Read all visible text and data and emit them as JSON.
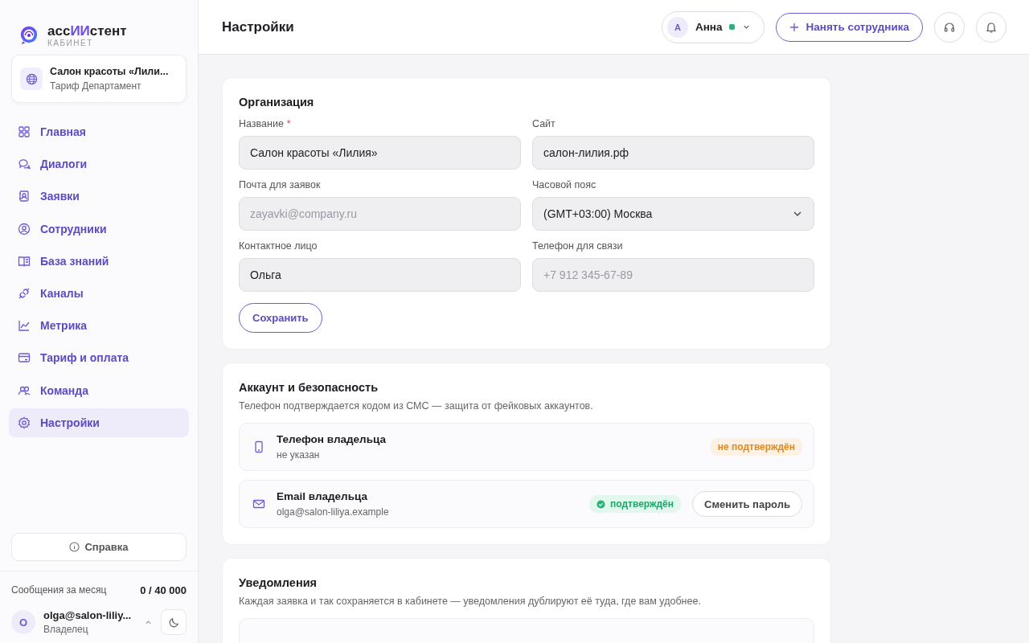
{
  "logo": {
    "parts": [
      {
        "text": "асс",
        "accent": false
      },
      {
        "text": "ИИ",
        "accent": true
      },
      {
        "text": "стент",
        "accent": false
      }
    ],
    "subtitle": "КАБИНЕТ"
  },
  "organization_card": {
    "name": "Салон красоты «Лили...",
    "plan": "Тариф Департамент"
  },
  "nav": [
    {
      "label": "Главная",
      "selected": false
    },
    {
      "label": "Диалоги",
      "selected": false
    },
    {
      "label": "Заявки",
      "selected": false
    },
    {
      "label": "Сотрудники",
      "selected": false
    },
    {
      "label": "База знаний",
      "selected": false
    },
    {
      "label": "Каналы",
      "selected": false
    },
    {
      "label": "Метрика",
      "selected": false
    },
    {
      "label": "Тариф и оплата",
      "selected": false
    },
    {
      "label": "Команда",
      "selected": false
    },
    {
      "label": "Настройки",
      "selected": true
    }
  ],
  "help_button": "Справка",
  "usage": {
    "label": "Сообщения за месяц",
    "value": "0 / 40 000"
  },
  "account": {
    "initial": "O",
    "email": "olga@salon-liliy...",
    "role": "Владелец"
  },
  "header": {
    "title": "Настройки",
    "user": {
      "initial": "А",
      "name": "Анна",
      "online": true
    },
    "hire_button": "Нанять сотрудника"
  },
  "organization": {
    "title": "Организация",
    "fields": [
      {
        "kind": "text",
        "label": "Название",
        "required_mark": "*",
        "value": "Салон красоты «Лилия»"
      },
      {
        "kind": "text",
        "label": "Сайт",
        "value": "салон-лилия.рф"
      },
      {
        "kind": "text",
        "label": "Почта для заявок",
        "placeholder": "zayavki@company.ru"
      },
      {
        "kind": "select",
        "label": "Часовой пояс",
        "value": "(GMT+03:00) Москва"
      },
      {
        "kind": "text",
        "label": "Контактное лицо",
        "value": "Ольга"
      },
      {
        "kind": "text",
        "label": "Телефон для связи",
        "placeholder": "+7 912 345-67-89"
      }
    ],
    "save_button": "Сохранить"
  },
  "security": {
    "title": "Аккаунт и безопасность",
    "description": "Телефон подтверждается кодом из СМС — защита от фейковых аккаунтов.",
    "rows": [
      {
        "kind": "phone",
        "title": "Телефон владельца",
        "value": "не указан",
        "verified": false,
        "status": "не подтверждён"
      },
      {
        "kind": "email",
        "title": "Email владельца",
        "value": "olga@salon-liliya.example",
        "verified": true,
        "status": "подтверждён",
        "action": "Сменить пароль"
      }
    ]
  },
  "notifications": {
    "title": "Уведомления",
    "description": "Каждая заявка и так сохраняется в кабинете — уведомления дублируют её туда, где вам удобнее."
  }
}
